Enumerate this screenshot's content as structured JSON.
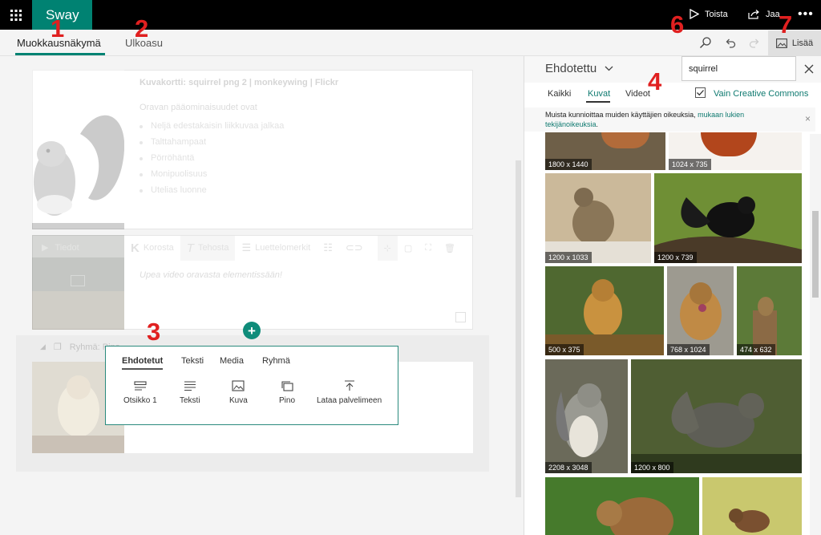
{
  "app": {
    "name": "Sway"
  },
  "topbar": {
    "play_label": "Toista",
    "share_label": "Jaa"
  },
  "tabs": {
    "edit": "Muokkausnäkymä",
    "design": "Ulkoasu"
  },
  "toolbar_right": {
    "insert_label": "Lisää"
  },
  "cards": {
    "image_card_caption": "Kuvakortti: squirrel png 2 | monkeywing | Flickr",
    "intro_text": "Oravan pääominaisuudet ovat",
    "bullets": [
      "Neljä edestakaisin liikkuvaa jalkaa",
      "Talttahampaat",
      "Pörröhäntä",
      "Monipuolisuus",
      "Utelias luonne"
    ],
    "details_label": "Tiedot",
    "video_text": "Upea video oravasta elementissään!",
    "group_label": "Ryhmä: Pino"
  },
  "format_toolbar": {
    "highlight": "Korosta",
    "emphasize": "Tehosta",
    "bullets": "Luettelomerkit"
  },
  "insert_popup": {
    "tabs": [
      "Ehdotetut",
      "Teksti",
      "Media",
      "Ryhmä"
    ],
    "items": [
      "Otsikko 1",
      "Teksti",
      "Kuva",
      "Pino",
      "Lataa palvelimeen"
    ]
  },
  "pane": {
    "source_label": "Ehdotettu",
    "search_value": "squirrel",
    "filter_tabs": [
      "Kaikki",
      "Kuvat",
      "Videot"
    ],
    "active_filter": "Kuvat",
    "cc_label": "Vain Creative Commons",
    "cc_checked": true,
    "notice_text": "Muista kunnioittaa muiden käyttäjien oikeuksia, ",
    "notice_link": "mukaan lukien tekijänoikeuksia",
    "notice_end": "."
  },
  "images": [
    "1800 x 1440",
    "1024 x 735",
    "1200 x 1033",
    "1200 x 739",
    "500 x 375",
    "768 x 1024",
    "474 x 632",
    "2208 x 3048",
    "1200 x 800"
  ],
  "annotations": [
    "1",
    "2",
    "3",
    "4",
    "6",
    "7"
  ],
  "colors": {
    "accent": "#008272",
    "annotation": "#e02020"
  }
}
